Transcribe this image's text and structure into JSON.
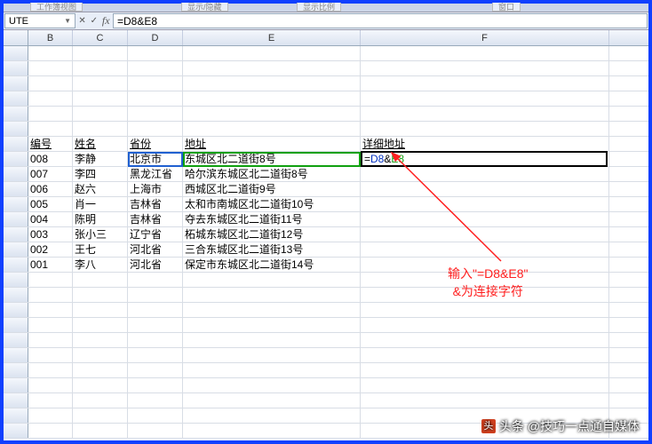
{
  "top_tabs": {
    "t1": "工作簿视图",
    "t2": "显示/隐藏",
    "t3": "显示比例",
    "t4": "窗口"
  },
  "namebox": "UTE",
  "fb": {
    "cancel": "✕",
    "confirm": "✓",
    "fx": "fx"
  },
  "formula": "=D8&E8",
  "columns": [
    "B",
    "C",
    "D",
    "E",
    "F"
  ],
  "headers": {
    "b": "编号",
    "c": "姓名",
    "d": "省份",
    "e": "地址",
    "f": "详细地址"
  },
  "edit": {
    "eq": "=",
    "d8": "D8",
    "amp": "&",
    "e8": "E8"
  },
  "annotation": {
    "line1": "输入\"=D8&E8\"",
    "line2": "&为连接字符"
  },
  "watermark": {
    "logo": "头",
    "text": "头条 @技巧一点通自媒体"
  },
  "chart_data": {
    "type": "table",
    "columns": [
      "编号",
      "姓名",
      "省份",
      "地址"
    ],
    "rows": [
      {
        "b": "008",
        "c": "李静",
        "d": "北京市",
        "e": "东城区北二道街8号"
      },
      {
        "b": "007",
        "c": "李四",
        "d": "黑龙江省",
        "e": "哈尔滨东城区北二道街8号"
      },
      {
        "b": "006",
        "c": "赵六",
        "d": "上海市",
        "e": "西城区北二道街9号"
      },
      {
        "b": "005",
        "c": "肖一",
        "d": "吉林省",
        "e": "太和市南城区北二道街10号"
      },
      {
        "b": "004",
        "c": "陈明",
        "d": "吉林省",
        "e": "夺去东城区北二道街11号"
      },
      {
        "b": "003",
        "c": "张小三",
        "d": "辽宁省",
        "e": "柘城东城区北二道街12号"
      },
      {
        "b": "002",
        "c": "王七",
        "d": "河北省",
        "e": "三合东城区北二道街13号"
      },
      {
        "b": "001",
        "c": "李八",
        "d": "河北省",
        "e": "保定市东城区北二道街14号"
      }
    ]
  }
}
